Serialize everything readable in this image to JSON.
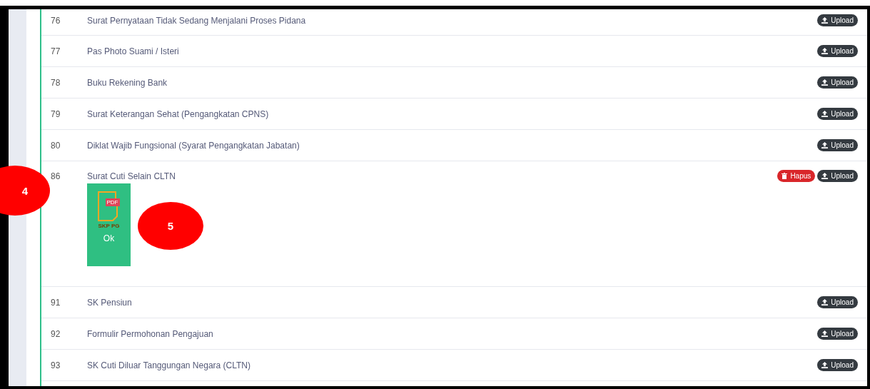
{
  "documents": [
    {
      "number": "76",
      "title": "Surat Pernyataan Tidak Sedang Menjalani Proses Pidana",
      "deletable": false,
      "upload_label": "Upload"
    },
    {
      "number": "77",
      "title": "Pas Photo Suami / Isteri",
      "deletable": false,
      "upload_label": "Upload"
    },
    {
      "number": "78",
      "title": "Buku Rekening Bank",
      "deletable": false,
      "upload_label": "Upload"
    },
    {
      "number": "79",
      "title": "Surat Keterangan Sehat (Pengangkatan CPNS)",
      "deletable": false,
      "upload_label": "Upload"
    },
    {
      "number": "80",
      "title": "Diklat Wajib Fungsional (Syarat Pengangkatan Jabatan)",
      "deletable": false,
      "upload_label": "Upload"
    },
    {
      "number": "86",
      "title": "Surat Cuti Selain CLTN",
      "deletable": true,
      "delete_label": "Hapus",
      "upload_label": "Upload",
      "attachment": {
        "badge": "PDF",
        "file_label": "SKP PG",
        "status": "Ok"
      }
    },
    {
      "number": "91",
      "title": "SK Pensiun",
      "deletable": false,
      "upload_label": "Upload"
    },
    {
      "number": "92",
      "title": "Formulir Permohonan Pengajuan",
      "deletable": false,
      "upload_label": "Upload"
    },
    {
      "number": "93",
      "title": "SK Cuti Diluar Tanggungan Negara (CLTN)",
      "deletable": false,
      "upload_label": "Upload"
    }
  ],
  "annotations": [
    {
      "label": "4"
    },
    {
      "label": "5"
    }
  ]
}
